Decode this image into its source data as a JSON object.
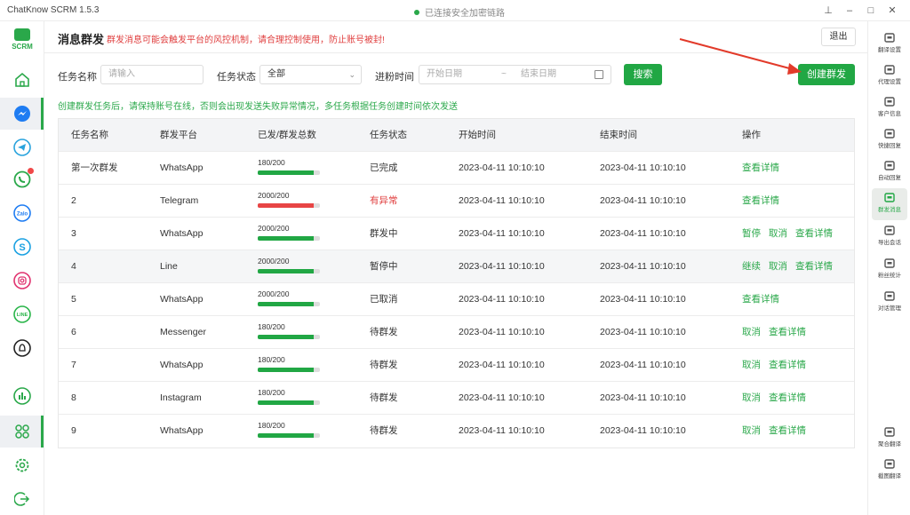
{
  "window": {
    "title": "ChatKnow SCRM 1.5.3",
    "secure_status": "已连接安全加密链路"
  },
  "logo": {
    "text": "SCRM"
  },
  "header": {
    "title": "消息群发",
    "warning": "群发消息可能会触发平台的风控机制，请合理控制使用，防止账号被封!",
    "logout": "退出"
  },
  "filters": {
    "task_name_label": "任务名称",
    "task_name_placeholder": "请输入",
    "task_status_label": "任务状态",
    "task_status_value": "全部",
    "time_label": "进粉时间",
    "start_placeholder": "开始日期",
    "range_sep": "~",
    "end_placeholder": "结束日期",
    "search_button": "搜索",
    "create_button": "创建群发"
  },
  "hint": "创建群发任务后，请保持账号在线，否则会出现发送失败异常情况，多任务根据任务创建时间依次发送",
  "table": {
    "headers": [
      "任务名称",
      "群发平台",
      "已发/群发总数",
      "任务状态",
      "开始时间",
      "结束时间",
      "操作"
    ],
    "rows": [
      {
        "name": "第一次群发",
        "platform": "WhatsApp",
        "progress": "180/200",
        "ratio": 0.9,
        "status": "已完成",
        "status_color": "#333333",
        "start": "2023-04-11 10:10:10",
        "end": "2023-04-11 10:10:10",
        "ops": [
          "查看详情"
        ]
      },
      {
        "name": "2",
        "platform": "Telegram",
        "progress": "2000/200",
        "ratio": 0.9,
        "status": "有异常",
        "status_color": "#e04040",
        "bar_color": "#e84545",
        "start": "2023-04-11 10:10:10",
        "end": "2023-04-11 10:10:10",
        "ops": [
          "查看详情"
        ]
      },
      {
        "name": "3",
        "platform": "WhatsApp",
        "progress": "2000/200",
        "ratio": 0.9,
        "status": "群发中",
        "status_color": "#333333",
        "start": "2023-04-11 10:10:10",
        "end": "2023-04-11 10:10:10",
        "ops": [
          "暂停",
          "取消",
          "查看详情"
        ]
      },
      {
        "name": "4",
        "platform": "Line",
        "progress": "2000/200",
        "ratio": 0.9,
        "status": "暂停中",
        "status_color": "#333333",
        "start": "2023-04-11 10:10:10",
        "end": "2023-04-11 10:10:10",
        "ops": [
          "继续",
          "取消",
          "查看详情"
        ],
        "highlight": true
      },
      {
        "name": "5",
        "platform": "WhatsApp",
        "progress": "2000/200",
        "ratio": 0.9,
        "status": "已取消",
        "status_color": "#333333",
        "start": "2023-04-11 10:10:10",
        "end": "2023-04-11 10:10:10",
        "ops": [
          "查看详情"
        ]
      },
      {
        "name": "6",
        "platform": "Messenger",
        "progress": "180/200",
        "ratio": 0.9,
        "status": "待群发",
        "status_color": "#333333",
        "start": "2023-04-11 10:10:10",
        "end": "2023-04-11 10:10:10",
        "ops": [
          "取消",
          "查看详情"
        ]
      },
      {
        "name": "7",
        "platform": "WhatsApp",
        "progress": "180/200",
        "ratio": 0.9,
        "status": "待群发",
        "status_color": "#333333",
        "start": "2023-04-11 10:10:10",
        "end": "2023-04-11 10:10:10",
        "ops": [
          "取消",
          "查看详情"
        ]
      },
      {
        "name": "8",
        "platform": "Instagram",
        "progress": "180/200",
        "ratio": 0.9,
        "status": "待群发",
        "status_color": "#333333",
        "start": "2023-04-11 10:10:10",
        "end": "2023-04-11 10:10:10",
        "ops": [
          "取消",
          "查看详情"
        ]
      },
      {
        "name": "9",
        "platform": "WhatsApp",
        "progress": "180/200",
        "ratio": 0.9,
        "status": "待群发",
        "status_color": "#333333",
        "start": "2023-04-11 10:10:10",
        "end": "2023-04-11 10:10:10",
        "ops": [
          "取消",
          "查看详情"
        ]
      }
    ]
  },
  "right_menu": [
    {
      "label": "翻译设置",
      "icon": "translate-icon"
    },
    {
      "label": "代理设置",
      "icon": "proxy-icon"
    },
    {
      "label": "客户信息",
      "icon": "customer-icon"
    },
    {
      "label": "快捷回复",
      "icon": "quick-reply-icon"
    },
    {
      "label": "自动回复",
      "icon": "robot-icon"
    },
    {
      "label": "群发消息",
      "icon": "broadcast-icon",
      "active": true
    },
    {
      "label": "导出会话",
      "icon": "export-icon"
    },
    {
      "label": "粉丝统计",
      "icon": "stats-icon"
    },
    {
      "label": "对话管理",
      "icon": "chat-manage-icon"
    },
    {
      "label": "聚合翻译",
      "icon": "aggregate-translate-icon"
    },
    {
      "label": "截图翻译",
      "icon": "crop-icon"
    }
  ],
  "left_nav": [
    {
      "name": "home-icon"
    },
    {
      "name": "messenger-icon",
      "active": true
    },
    {
      "name": "telegram-icon"
    },
    {
      "name": "whatsapp-icon",
      "badge": true
    },
    {
      "name": "zalo-icon"
    },
    {
      "name": "skype-icon"
    },
    {
      "name": "instagram-icon"
    },
    {
      "name": "line-icon"
    },
    {
      "name": "snapchat-icon"
    },
    {
      "name": "statistics-icon"
    },
    {
      "name": "apps-icon",
      "active": true
    },
    {
      "name": "settings-icon"
    },
    {
      "name": "logout-icon"
    }
  ],
  "colors": {
    "accent": "#21a744",
    "danger": "#e04040",
    "bar_bg": "#dddddd"
  },
  "annotation_arrow_color": "#e23a2a"
}
